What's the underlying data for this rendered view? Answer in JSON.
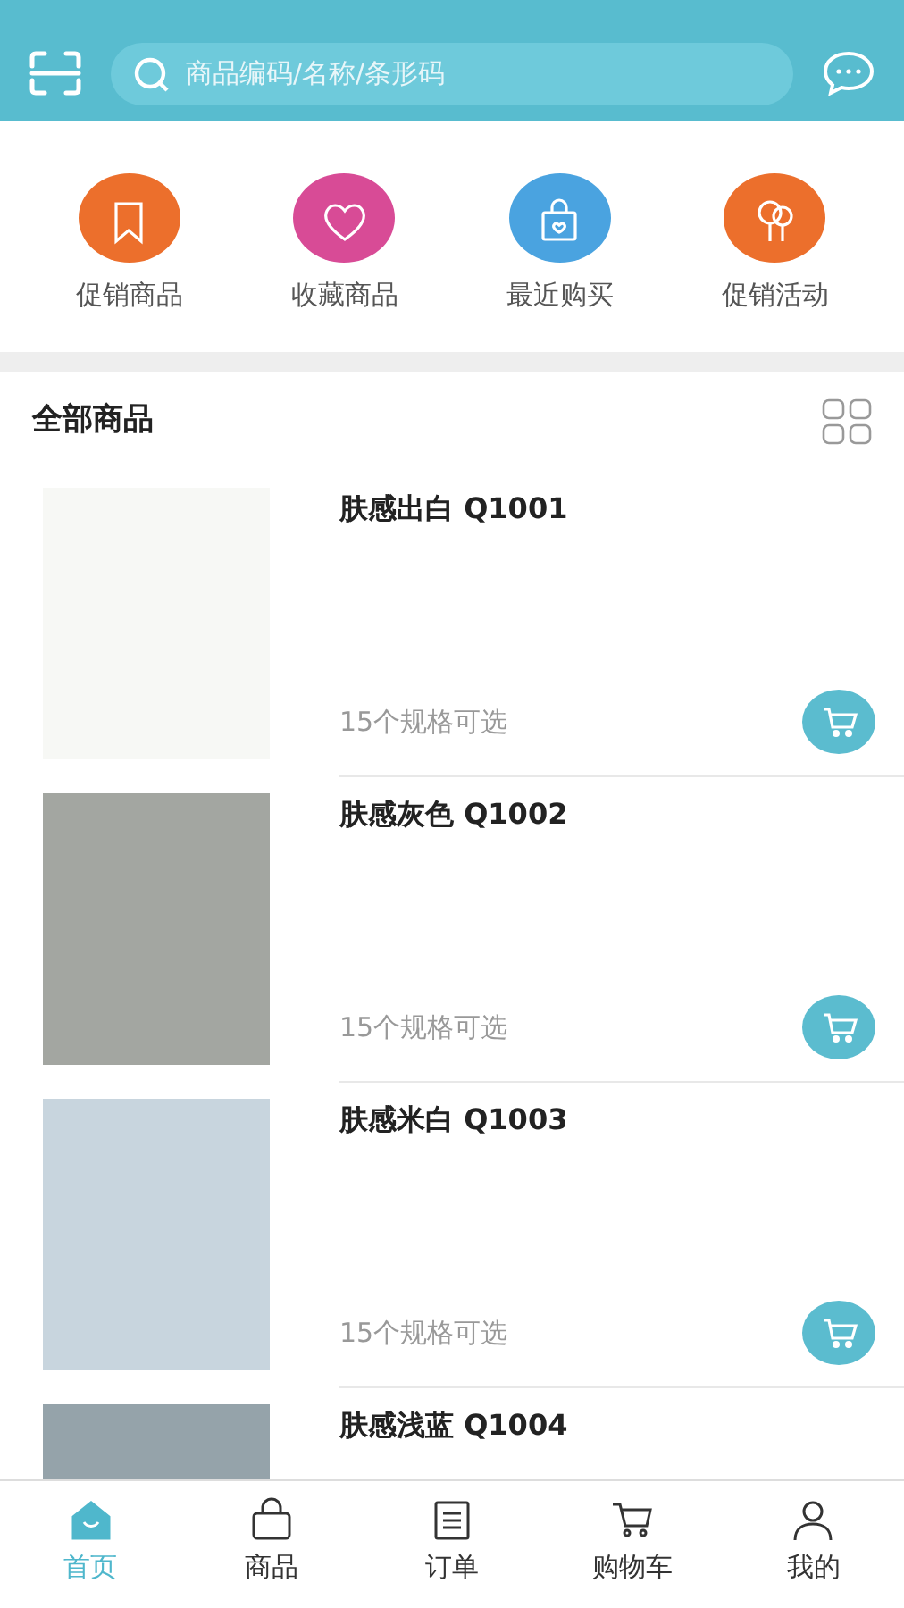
{
  "search": {
    "placeholder": "商品编码/名称/条形码"
  },
  "shortcuts": [
    {
      "label": "促销商品",
      "kind": "bookmark",
      "color": "#ec6f2c"
    },
    {
      "label": "收藏商品",
      "kind": "heart",
      "color": "#d84b96"
    },
    {
      "label": "最近购买",
      "kind": "bag",
      "color": "#4aa3e0"
    },
    {
      "label": "促销活动",
      "kind": "balloon",
      "color": "#ec6f2c"
    }
  ],
  "section": {
    "title": "全部商品"
  },
  "products": [
    {
      "name": "肤感出白 Q1001",
      "specs": "15个规格可选",
      "color": "#f7f8f5"
    },
    {
      "name": "肤感灰色 Q1002",
      "specs": "15个规格可选",
      "color": "#a3a6a1"
    },
    {
      "name": "肤感米白 Q1003",
      "specs": "15个规格可选",
      "color": "#c8d5de"
    },
    {
      "name": "肤感浅蓝 Q1004",
      "color": "#95a3aa"
    }
  ],
  "tabs": [
    {
      "label": "首页",
      "kind": "home",
      "selected": true
    },
    {
      "label": "商品",
      "kind": "bag",
      "selected": false
    },
    {
      "label": "订单",
      "kind": "list",
      "selected": false
    },
    {
      "label": "购物车",
      "kind": "cart",
      "selected": false
    },
    {
      "label": "我的",
      "kind": "person",
      "selected": false
    }
  ]
}
